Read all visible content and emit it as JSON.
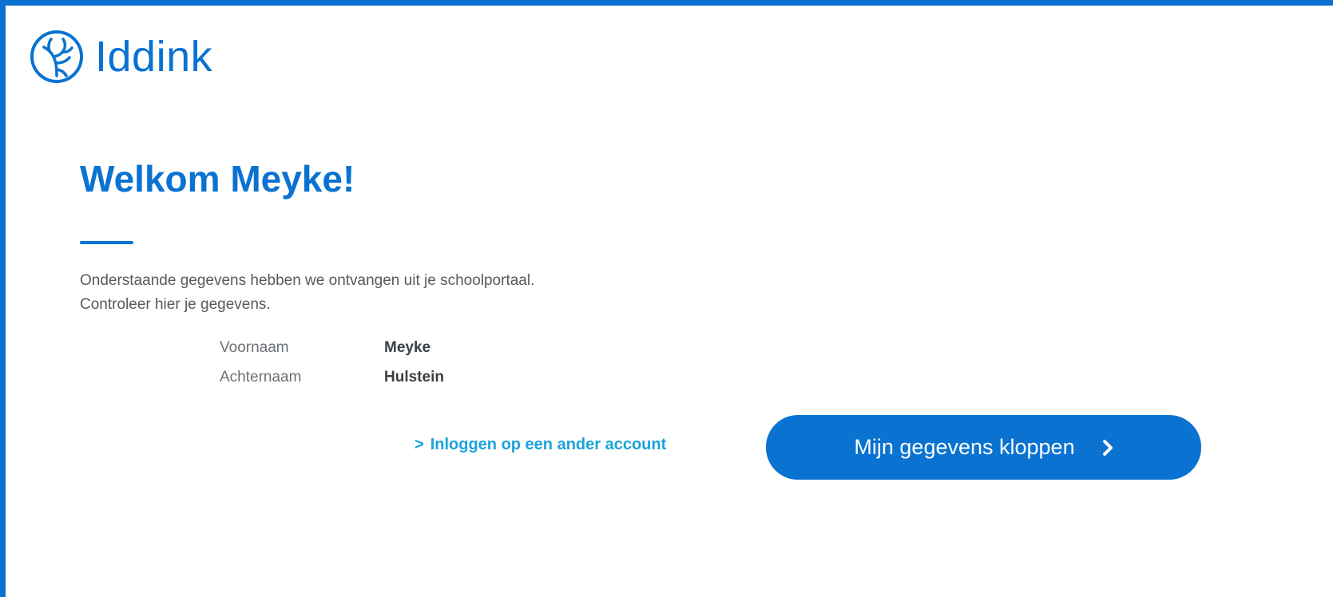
{
  "brand": {
    "name": "Iddink",
    "logo_icon": "deer-antler-logo-icon",
    "accent_color": "#0a72d1",
    "link_color": "#1aa3dc"
  },
  "welcome": {
    "title": "Welkom Meyke!"
  },
  "intro": {
    "line1": "Onderstaande gegevens hebben we ontvangen uit je schoolportaal.",
    "line2": "Controleer hier je gegevens."
  },
  "details": [
    {
      "label": "Voornaam",
      "value": "Meyke"
    },
    {
      "label": "Achternaam",
      "value": "Hulstein"
    }
  ],
  "actions": {
    "alt_account_chevron": ">",
    "alt_account_label": "Inloggen op een ander account",
    "confirm_label": "Mijn gegevens kloppen",
    "confirm_icon": "chevron-right-icon"
  }
}
